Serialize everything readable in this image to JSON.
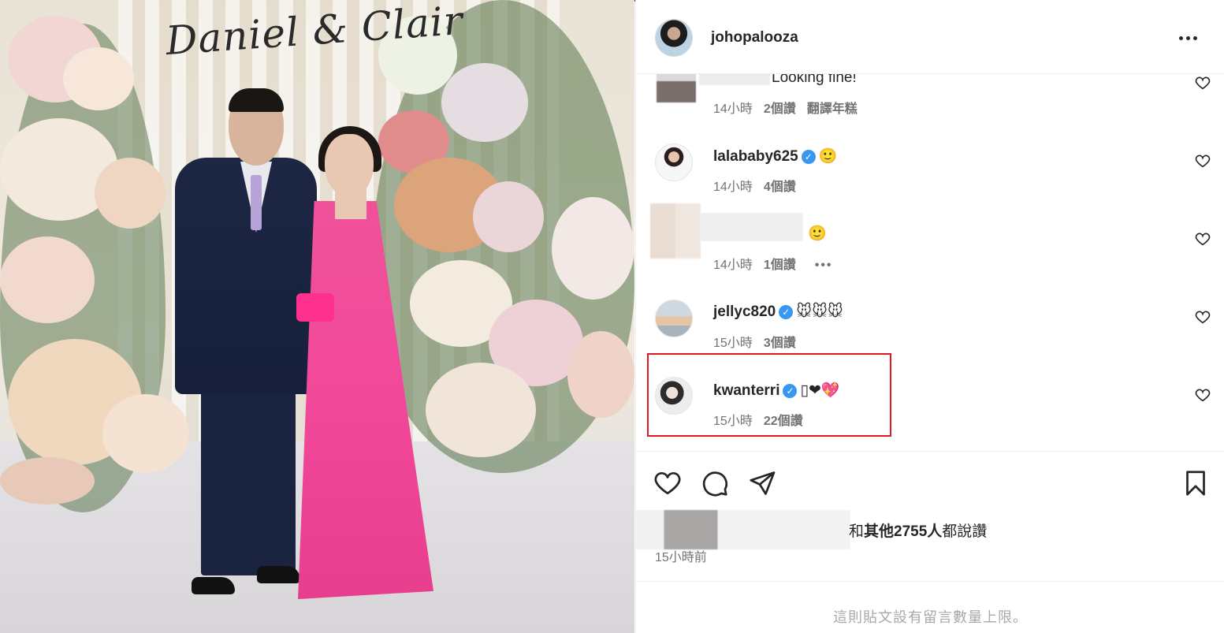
{
  "photo": {
    "sign_text": "Daniel & Clair"
  },
  "post": {
    "author": "johopalooza",
    "more_label": "more-options"
  },
  "comments": [
    {
      "username": "",
      "text": "Looking fine!",
      "time": "14小時",
      "likes": "2個讚",
      "extra": "翻譯年糕",
      "verified": false
    },
    {
      "username": "lalababy625",
      "text": "🙂",
      "time": "14小時",
      "likes": "4個讚",
      "verified": true
    },
    {
      "username": "",
      "text": "🙂",
      "time": "14小時",
      "likes": "1個讚",
      "extra": "•••",
      "verified": false
    },
    {
      "username": "jellyc820",
      "text": "🐭🐭🐭",
      "time": "15小時",
      "likes": "3個讚",
      "verified": true
    },
    {
      "username": "kwanterri",
      "text": "▯❤💖",
      "time": "15小時",
      "likes": "22個讚",
      "verified": true
    }
  ],
  "actions": {
    "likes_prefix": "和",
    "likes_count": "其他2755人",
    "likes_suffix": "都說讚",
    "posted": "15小時前"
  },
  "footer": {
    "limited": "這則貼文設有留言數量上限。"
  },
  "colors": {
    "highlight": "#e2191c",
    "verified": "#3897f0",
    "dress": "#f0529a"
  }
}
